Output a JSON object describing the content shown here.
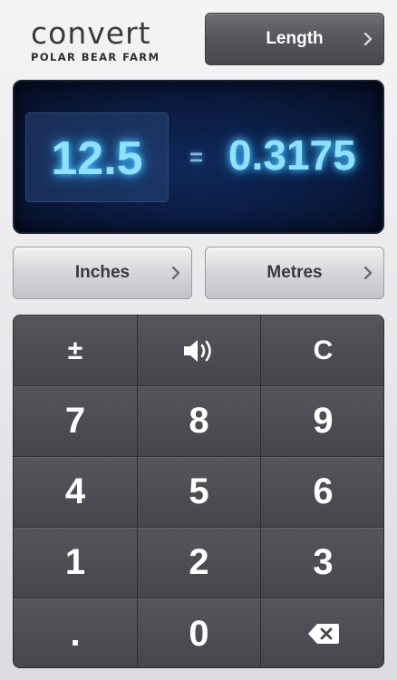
{
  "app": {
    "logo_word": "convert",
    "logo_subtitle": "POLAR BEAR FARM"
  },
  "category": {
    "label": "Length"
  },
  "display": {
    "input_value": "12.5",
    "equals": "=",
    "output_value": "0.3175"
  },
  "units": {
    "from_label": "Inches",
    "to_label": "Metres"
  },
  "keypad": {
    "plus_minus": "±",
    "sound_icon": "speaker-icon",
    "clear": "C",
    "k7": "7",
    "k8": "8",
    "k9": "9",
    "k4": "4",
    "k5": "5",
    "k6": "6",
    "k1": "1",
    "k2": "2",
    "k3": "3",
    "decimal": ".",
    "k0": "0",
    "backspace_icon": "backspace-icon"
  },
  "colors": {
    "display_glow": "#8fe2ff",
    "display_bg": "#0a1a3e",
    "keypad_bg": "#45464b"
  }
}
